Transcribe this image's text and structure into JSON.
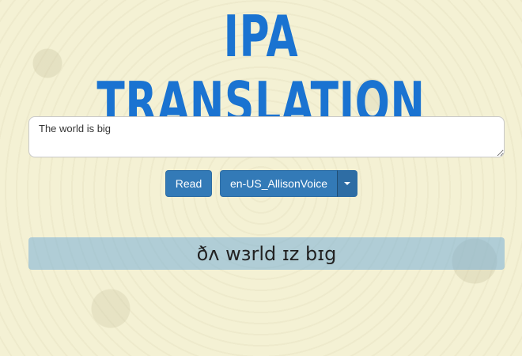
{
  "header": {
    "title": "IPA TRANSLATION"
  },
  "input": {
    "value": "The world is big"
  },
  "controls": {
    "read_label": "Read",
    "voice_selected": "en-US_AllisonVoice",
    "dropdown_icon": "caret-down-icon"
  },
  "result": {
    "ipa_text": "ðʌ wɜrld ɪz bɪg"
  },
  "colors": {
    "title": "#1a73d1",
    "button": "#337ab7",
    "result_background": "#8fbbd9",
    "page_background": "#f4f1d4"
  }
}
